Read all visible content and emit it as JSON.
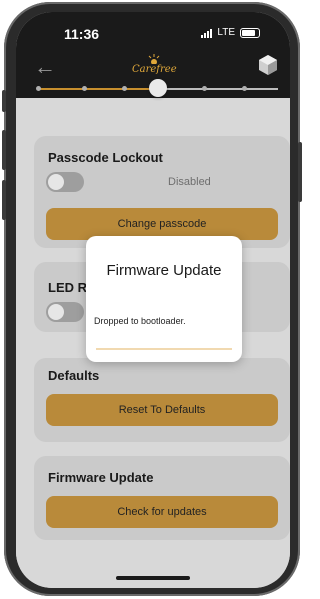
{
  "status": {
    "time": "11:36",
    "network": "LTE"
  },
  "header": {
    "logo_text": "Carefree",
    "back_icon": "back-arrow-icon",
    "device_icon": "cube-icon"
  },
  "brightness_slider": {
    "level": 0.5
  },
  "passcode": {
    "title": "Passcode Lockout",
    "status": "Disabled",
    "button": "Change passcode"
  },
  "led": {
    "title_visible": "LED R"
  },
  "defaults": {
    "title": "Defaults",
    "button": "Reset To Defaults"
  },
  "firmware": {
    "title": "Firmware Update",
    "button": "Check for updates"
  },
  "dialog": {
    "title": "Firmware Update",
    "message": "Dropped to bootloader.",
    "progress": 0.0
  },
  "colors": {
    "accent": "#b98a3a",
    "logo": "#e0a83a"
  }
}
